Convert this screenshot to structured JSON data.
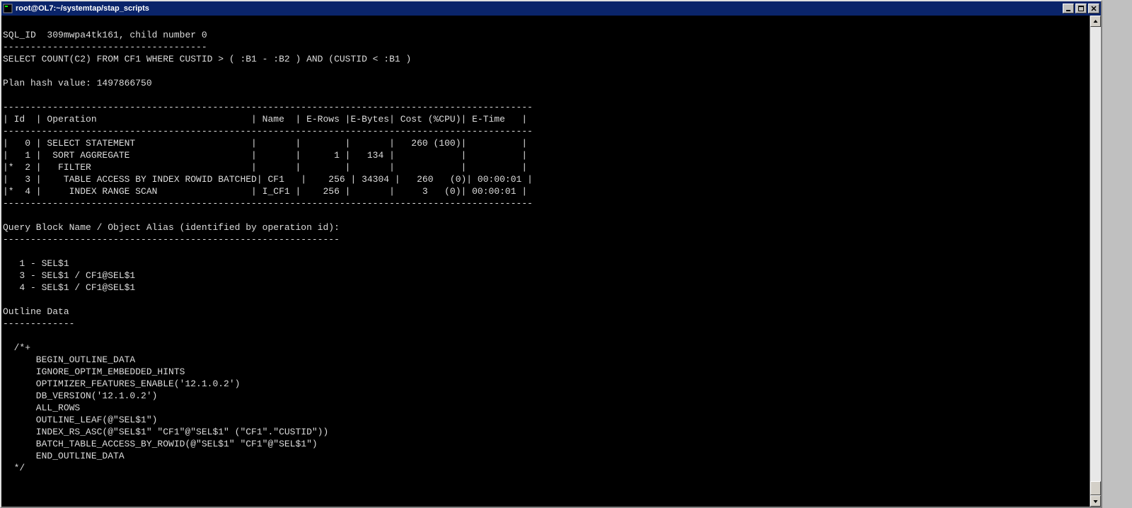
{
  "window": {
    "title": "root@OL7:~/systemtap/stap_scripts"
  },
  "terminal": {
    "lines": [
      "",
      "SQL_ID  309mwpa4tk161, child number 0",
      "-------------------------------------",
      "SELECT COUNT(C2) FROM CF1 WHERE CUSTID > ( :B1 - :B2 ) AND (CUSTID < :B1 )",
      "",
      "Plan hash value: 1497866750",
      "",
      "------------------------------------------------------------------------------------------------",
      "| Id  | Operation                            | Name  | E-Rows |E-Bytes| Cost (%CPU)| E-Time   |",
      "------------------------------------------------------------------------------------------------",
      "|   0 | SELECT STATEMENT                     |       |        |       |   260 (100)|          |",
      "|   1 |  SORT AGGREGATE                      |       |      1 |   134 |            |          |",
      "|*  2 |   FILTER                             |       |        |       |            |          |",
      "|   3 |    TABLE ACCESS BY INDEX ROWID BATCHED| CF1   |    256 | 34304 |   260   (0)| 00:00:01 |",
      "|*  4 |     INDEX RANGE SCAN                 | I_CF1 |    256 |       |     3   (0)| 00:00:01 |",
      "------------------------------------------------------------------------------------------------",
      "",
      "Query Block Name / Object Alias (identified by operation id):",
      "-------------------------------------------------------------",
      "",
      "   1 - SEL$1",
      "   3 - SEL$1 / CF1@SEL$1",
      "   4 - SEL$1 / CF1@SEL$1",
      "",
      "Outline Data",
      "-------------",
      "",
      "  /*+",
      "      BEGIN_OUTLINE_DATA",
      "      IGNORE_OPTIM_EMBEDDED_HINTS",
      "      OPTIMIZER_FEATURES_ENABLE('12.1.0.2')",
      "      DB_VERSION('12.1.0.2')",
      "      ALL_ROWS",
      "      OUTLINE_LEAF(@\"SEL$1\")",
      "      INDEX_RS_ASC(@\"SEL$1\" \"CF1\"@\"SEL$1\" (\"CF1\".\"CUSTID\"))",
      "      BATCH_TABLE_ACCESS_BY_ROWID(@\"SEL$1\" \"CF1\"@\"SEL$1\")",
      "      END_OUTLINE_DATA",
      "  */"
    ]
  }
}
